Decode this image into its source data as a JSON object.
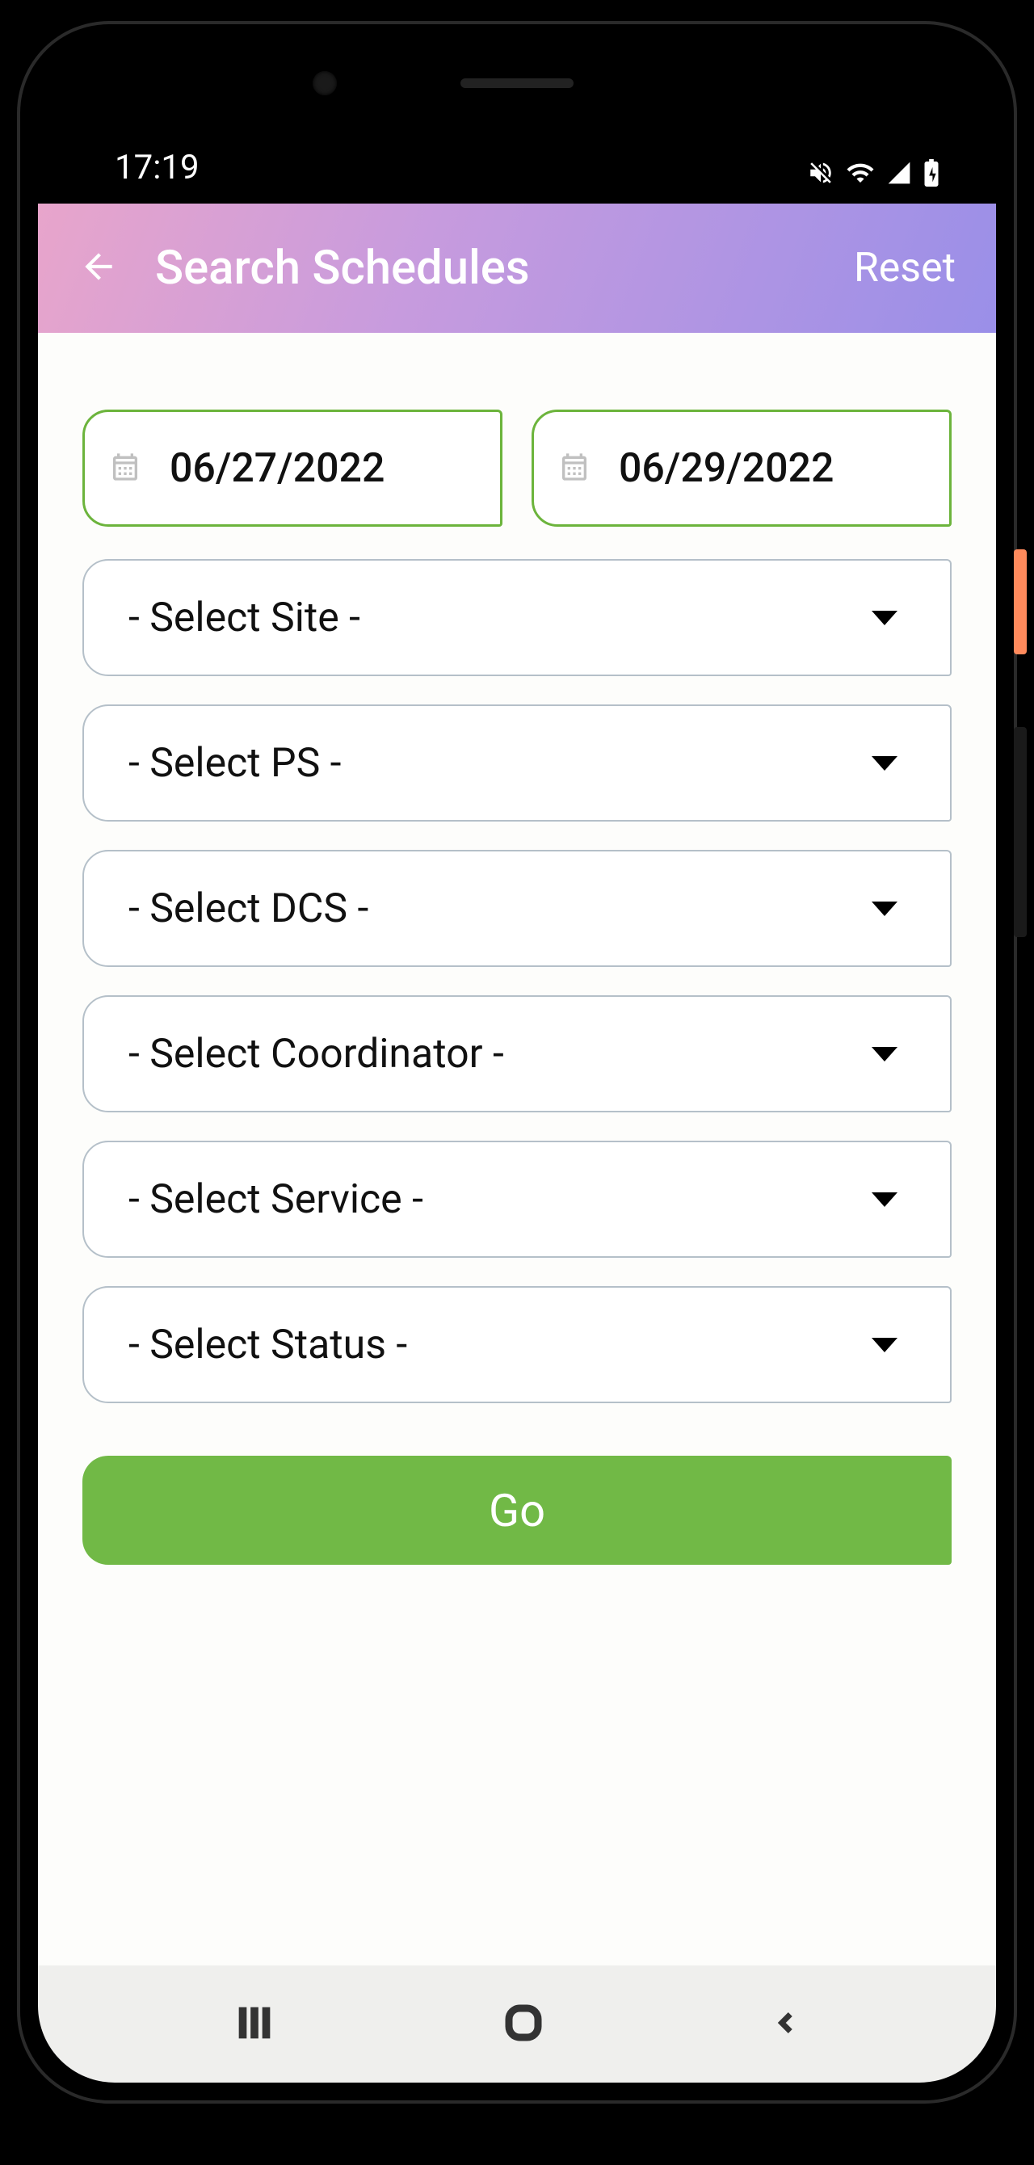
{
  "statusBar": {
    "time": "17:19"
  },
  "header": {
    "title": "Search Schedules",
    "resetLabel": "Reset"
  },
  "dates": {
    "from": "06/27/2022",
    "to": "06/29/2022"
  },
  "selects": {
    "site": "- Select Site -",
    "ps": "- Select PS -",
    "dcs": "- Select DCS -",
    "coordinator": "- Select Coordinator -",
    "service": "- Select Service -",
    "status": "- Select Status -"
  },
  "goLabel": "Go"
}
